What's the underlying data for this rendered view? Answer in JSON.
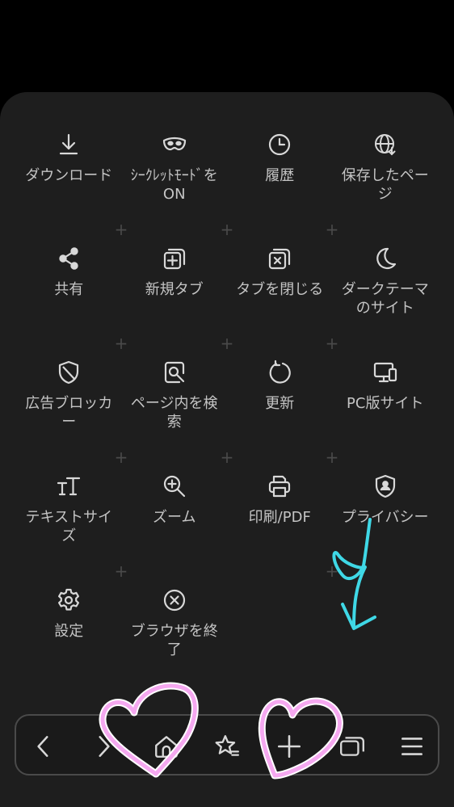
{
  "menu": {
    "rows": [
      [
        {
          "id": "download",
          "icon": "download-icon",
          "label": "ダウンロード"
        },
        {
          "id": "secret-mode",
          "icon": "mask-icon",
          "label": "ｼｰｸﾚｯﾄﾓｰﾄﾞを ON"
        },
        {
          "id": "history",
          "icon": "clock-icon",
          "label": "履歴"
        },
        {
          "id": "saved-pages",
          "icon": "globe-download-icon",
          "label": "保存したページ"
        }
      ],
      [
        {
          "id": "share",
          "icon": "share-icon",
          "label": "共有"
        },
        {
          "id": "new-tab",
          "icon": "new-tab-icon",
          "label": "新規タブ"
        },
        {
          "id": "close-tab",
          "icon": "close-tab-icon",
          "label": "タブを閉じる"
        },
        {
          "id": "dark-theme",
          "icon": "moon-icon",
          "label": "ダークテーマのサイト"
        }
      ],
      [
        {
          "id": "ad-blocker",
          "icon": "shield-icon",
          "label": "広告ブロッカー"
        },
        {
          "id": "find-in-page",
          "icon": "find-in-page-icon",
          "label": "ページ内を検索"
        },
        {
          "id": "refresh",
          "icon": "refresh-icon",
          "label": "更新"
        },
        {
          "id": "desktop-site",
          "icon": "desktop-icon",
          "label": "PC版サイト"
        }
      ],
      [
        {
          "id": "text-size",
          "icon": "text-size-icon",
          "label": "テキストサイズ"
        },
        {
          "id": "zoom",
          "icon": "zoom-in-icon",
          "label": "ズーム"
        },
        {
          "id": "print",
          "icon": "printer-icon",
          "label": "印刷/PDF"
        },
        {
          "id": "privacy",
          "icon": "privacy-shield-icon",
          "label": "プライバシー"
        }
      ],
      [
        {
          "id": "settings",
          "icon": "gear-icon",
          "label": "設定"
        },
        {
          "id": "quit-browser",
          "icon": "close-circle-icon",
          "label": "ブラウザを終了"
        }
      ]
    ]
  },
  "bottom_bar": {
    "buttons": [
      {
        "id": "back",
        "icon": "back-arrow-icon"
      },
      {
        "id": "forward",
        "icon": "forward-arrow-icon"
      },
      {
        "id": "home",
        "icon": "home-icon"
      },
      {
        "id": "bookmarks",
        "icon": "star-list-icon"
      },
      {
        "id": "add-tab",
        "icon": "plus-icon"
      },
      {
        "id": "tabs",
        "icon": "tabs-icon"
      },
      {
        "id": "menu",
        "icon": "hamburger-menu-icon"
      }
    ]
  },
  "colors": {
    "background": "#000000",
    "panel": "#1e1e1e",
    "icon": "#d8d8d8",
    "label": "#c4c4c4",
    "separator_plus": "#4a4a4a",
    "heart_annotation": "#f5a8f0",
    "arrow_annotation": "#3fd8e6"
  }
}
